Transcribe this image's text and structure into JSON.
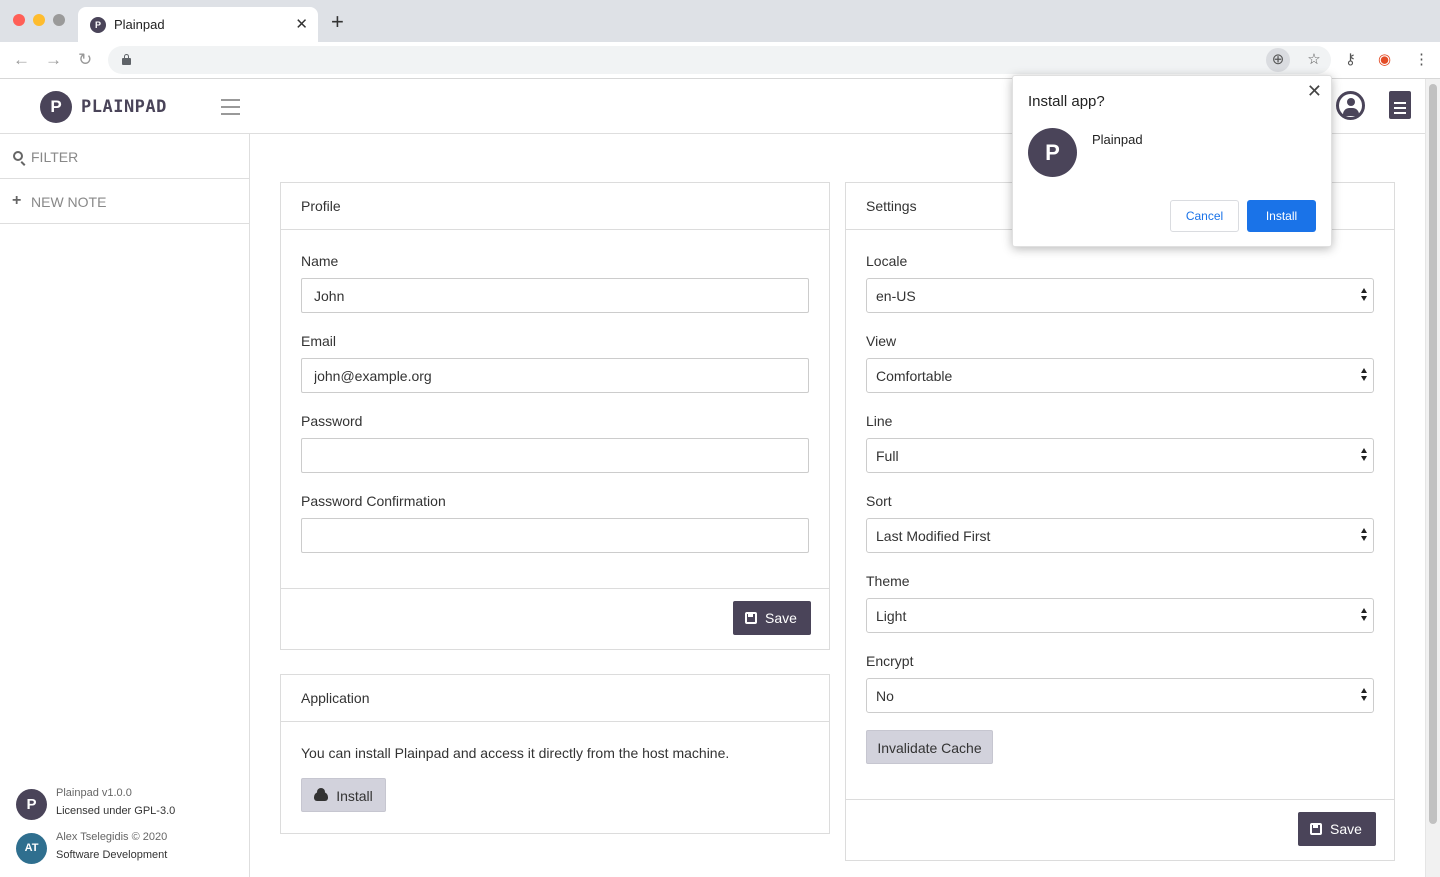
{
  "browser": {
    "tab_title": "Plainpad",
    "tab_favicon": "P",
    "close_glyph": "✕",
    "newtab_glyph": "+",
    "back_glyph": "←",
    "forward_glyph": "→",
    "reload_glyph": "↻",
    "install_glyph": "⊕",
    "star_glyph": "☆",
    "key_glyph": "⚷",
    "ext_glyph": "◉",
    "menu_glyph": "⋮"
  },
  "app": {
    "logo_letter": "P",
    "brand": "PLAINPAD"
  },
  "sidebar": {
    "filter_label": "FILTER",
    "new_note_label": "NEW NOTE",
    "plus_glyph": "+",
    "footer": {
      "version_line1": "Plainpad v1.0.0",
      "version_line2": "Licensed under GPL-3.0",
      "logo_letter": "P",
      "author_line1": "Alex Tselegidis © 2020",
      "author_line2": "Software Development",
      "author_logo": "AT"
    }
  },
  "profile": {
    "title": "Profile",
    "name_label": "Name",
    "name_value": "John",
    "email_label": "Email",
    "email_value": "john@example.org",
    "password_label": "Password",
    "password_confirm_label": "Password Confirmation",
    "save_label": "Save"
  },
  "application": {
    "title": "Application",
    "description": "You can install Plainpad and access it directly from the host machine.",
    "install_label": "Install"
  },
  "settings": {
    "title": "Settings",
    "locale_label": "Locale",
    "locale_value": "en-US",
    "view_label": "View",
    "view_value": "Comfortable",
    "line_label": "Line",
    "line_value": "Full",
    "sort_label": "Sort",
    "sort_value": "Last Modified First",
    "theme_label": "Theme",
    "theme_value": "Light",
    "encrypt_label": "Encrypt",
    "encrypt_value": "No",
    "invalidate_label": "Invalidate Cache",
    "save_label": "Save"
  },
  "install_popup": {
    "title": "Install app?",
    "app_name": "Plainpad",
    "logo_letter": "P",
    "cancel_label": "Cancel",
    "install_label": "Install",
    "close_glyph": "✕"
  },
  "colors": {
    "brand": "#4a4459",
    "chrome_primary": "#1a73e8"
  }
}
